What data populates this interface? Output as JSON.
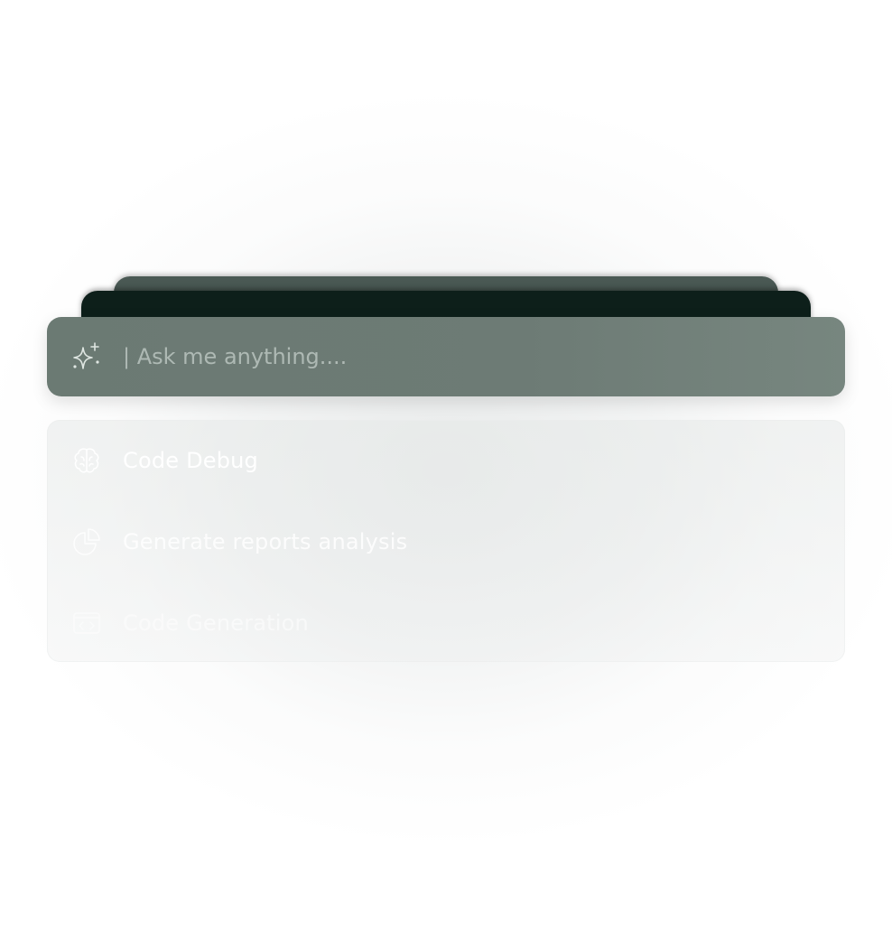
{
  "search": {
    "placeholder": "| Ask me anything...."
  },
  "suggestions": [
    {
      "label": "Code Debug",
      "icon": "brain-icon"
    },
    {
      "label": "Generate reports analysis",
      "icon": "pie-chart-icon"
    },
    {
      "label": "Code Generation",
      "icon": "code-icon"
    }
  ],
  "colors": {
    "search_bar": "#6d7b75",
    "stack_back": "#43524c",
    "stack_mid": "#0d1f1a",
    "placeholder": "#aeb9b4",
    "suggestion_text": "#ffffff"
  }
}
